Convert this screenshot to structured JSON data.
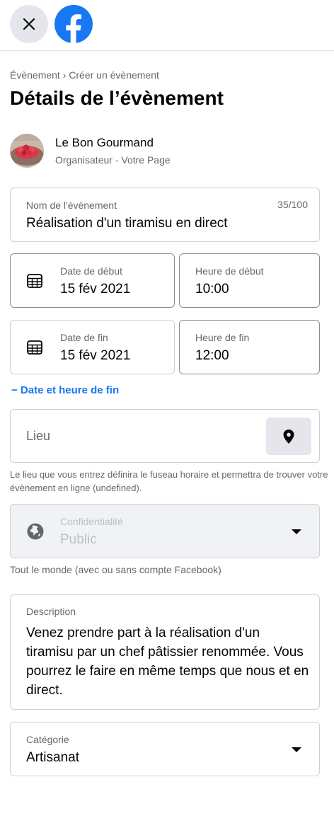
{
  "header": {
    "close_icon": "close-icon",
    "logo_icon": "facebook-logo-icon",
    "brand_color": "#1877f2"
  },
  "breadcrumb": {
    "text": "Évènement › Créer un évènement"
  },
  "page_title": "Détails de l’évènement",
  "host": {
    "name": "Le Bon Gourmand",
    "role": "Organisateur - Votre Page"
  },
  "event_name": {
    "label": "Nom de l'évènement",
    "counter": "35/100",
    "value": "Réalisation d'un tiramisu en direct"
  },
  "start": {
    "date_label": "Date de début",
    "date_value": "15 fév 2021",
    "time_label": "Heure de début",
    "time_value": "10:00"
  },
  "end": {
    "date_label": "Date de fin",
    "date_value": "15 fév 2021",
    "time_label": "Heure de fin",
    "time_value": "12:00"
  },
  "end_toggle": {
    "label": "− Date et heure de fin"
  },
  "location": {
    "placeholder": "Lieu",
    "help": "Le lieu que vous entrez définira le fuseau horaire et permettra de trouver votre évènement en ligne (undefined).",
    "pin_icon": "map-pin-icon"
  },
  "privacy": {
    "label": "Confidentialité",
    "value": "Public",
    "help": "Tout le monde (avec ou sans compte Facebook)",
    "icon": "globe-icon"
  },
  "description": {
    "label": "Description",
    "value": "Venez prendre part à la réalisation d'un tiramisu par un chef pâtissier renommée. Vous pourrez le faire en même temps que nous et en direct."
  },
  "category": {
    "label": "Catégorie",
    "value": "Artisanat"
  }
}
